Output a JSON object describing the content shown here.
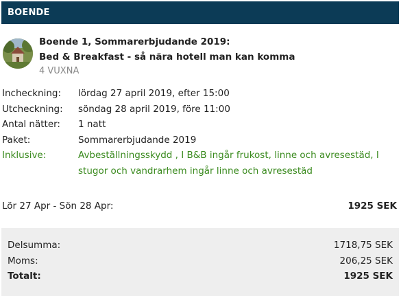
{
  "header": {
    "title": "BOENDE"
  },
  "item": {
    "title_line1": "Boende 1, Sommarerbjudande 2019:",
    "title_line2": "Bed & Breakfast - så nära hotell man kan komma",
    "guests": "4 VUXNA"
  },
  "details": [
    {
      "label": "Incheckning:",
      "value": "lördag 27 april 2019, efter 15:00"
    },
    {
      "label": "Utcheckning:",
      "value": "söndag 28 april 2019, före 11:00"
    },
    {
      "label": "Antal nätter:",
      "value": "1 natt"
    },
    {
      "label": "Paket:",
      "value": "Sommarerbjudande 2019"
    },
    {
      "label": "Inklusive:",
      "value": "Avbeställningsskydd , I B&B ingår frukost, linne och avresestäd, I stugor och vandrarhem ingår linne och avresestäd"
    }
  ],
  "dates": {
    "range": "Lör 27 Apr - Sön 28 Apr:",
    "amount": "1925 SEK"
  },
  "summary": {
    "subtotal_label": "Delsumma:",
    "subtotal_value": "1718,75 SEK",
    "vat_label": "Moms:",
    "vat_value": "206,25 SEK",
    "total_label": "Totalt:",
    "total_value": "1925 SEK"
  },
  "colors": {
    "header_bg": "#0c3b56",
    "inclusive_text": "#3a8a1e",
    "summary_bg": "#eeeeee"
  }
}
